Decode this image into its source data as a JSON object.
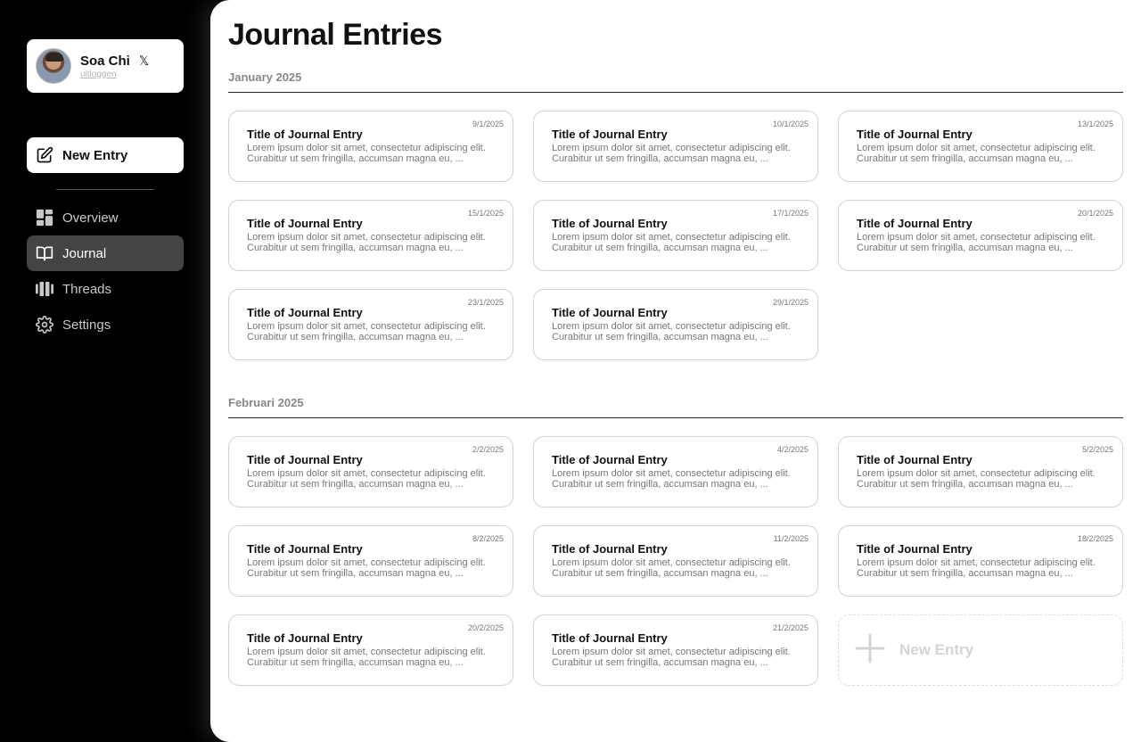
{
  "colors": {
    "sidebar_bg": "#000000",
    "main_bg": "#ffffff",
    "active_nav": "#444444",
    "muted": "#888888"
  },
  "profile": {
    "name": "Soa Chi",
    "logout": "uitloggen",
    "x_icon": "𝕏"
  },
  "sidebar": {
    "new_entry": "New Entry",
    "nav": [
      {
        "label": "Overview",
        "icon": "overview-icon",
        "active": false
      },
      {
        "label": "Journal",
        "icon": "book-icon",
        "active": true
      },
      {
        "label": "Threads",
        "icon": "threads-icon",
        "active": false
      },
      {
        "label": "Settings",
        "icon": "gear-icon",
        "active": false
      }
    ]
  },
  "page": {
    "title": "Journal Entries"
  },
  "sections": [
    {
      "label": "January 2025",
      "entries": [
        {
          "date": "9/1/2025",
          "title": "Title of Journal Entry",
          "body": "Lorem ipsum dolor sit amet, consectetur adipiscing elit. Curabitur ut sem fringilla, accumsan magna eu, ..."
        },
        {
          "date": "10/1/2025",
          "title": "Title of Journal Entry",
          "body": "Lorem ipsum dolor sit amet, consectetur adipiscing elit. Curabitur ut sem fringilla, accumsan magna eu, ..."
        },
        {
          "date": "13/1/2025",
          "title": "Title of Journal Entry",
          "body": "Lorem ipsum dolor sit amet, consectetur adipiscing elit. Curabitur ut sem fringilla, accumsan magna eu, ..."
        },
        {
          "date": "15/1/2025",
          "title": "Title of Journal Entry",
          "body": "Lorem ipsum dolor sit amet, consectetur adipiscing elit. Curabitur ut sem fringilla, accumsan magna eu, ..."
        },
        {
          "date": "17/1/2025",
          "title": "Title of Journal Entry",
          "body": "Lorem ipsum dolor sit amet, consectetur adipiscing elit. Curabitur ut sem fringilla, accumsan magna eu, ..."
        },
        {
          "date": "20/1/2025",
          "title": "Title of Journal Entry",
          "body": "Lorem ipsum dolor sit amet, consectetur adipiscing elit. Curabitur ut sem fringilla, accumsan magna eu, ..."
        },
        {
          "date": "23/1/2025",
          "title": "Title of Journal Entry",
          "body": "Lorem ipsum dolor sit amet, consectetur adipiscing elit. Curabitur ut sem fringilla, accumsan magna eu, ..."
        },
        {
          "date": "29/1/2025",
          "title": "Title of Journal Entry",
          "body": "Lorem ipsum dolor sit amet, consectetur adipiscing elit. Curabitur ut sem fringilla, accumsan magna eu, ..."
        }
      ]
    },
    {
      "label": "Februari 2025",
      "entries": [
        {
          "date": "2/2/2025",
          "title": "Title of Journal Entry",
          "body": "Lorem ipsum dolor sit amet, consectetur adipiscing elit. Curabitur ut sem fringilla, accumsan magna eu, ..."
        },
        {
          "date": "4/2/2025",
          "title": "Title of Journal Entry",
          "body": "Lorem ipsum dolor sit amet, consectetur adipiscing elit. Curabitur ut sem fringilla, accumsan magna eu, ..."
        },
        {
          "date": "5/2/2025",
          "title": "Title of Journal Entry",
          "body": "Lorem ipsum dolor sit amet, consectetur adipiscing elit. Curabitur ut sem fringilla, accumsan magna eu, ..."
        },
        {
          "date": "8/2/2025",
          "title": "Title of Journal Entry",
          "body": "Lorem ipsum dolor sit amet, consectetur adipiscing elit. Curabitur ut sem fringilla, accumsan magna eu, ..."
        },
        {
          "date": "11/2/2025",
          "title": "Title of Journal Entry",
          "body": "Lorem ipsum dolor sit amet, consectetur adipiscing elit. Curabitur ut sem fringilla, accumsan magna eu, ..."
        },
        {
          "date": "18/2/2025",
          "title": "Title of Journal Entry",
          "body": "Lorem ipsum dolor sit amet, consectetur adipiscing elit. Curabitur ut sem fringilla, accumsan magna eu, ..."
        },
        {
          "date": "20/2/2025",
          "title": "Title of Journal Entry",
          "body": "Lorem ipsum dolor sit amet, consectetur adipiscing elit. Curabitur ut sem fringilla, accumsan magna eu, ..."
        },
        {
          "date": "21/2/2025",
          "title": "Title of Journal Entry",
          "body": "Lorem ipsum dolor sit amet, consectetur adipiscing elit. Curabitur ut sem fringilla, accumsan magna eu, ..."
        }
      ],
      "new_entry_label": "New Entry"
    }
  ]
}
